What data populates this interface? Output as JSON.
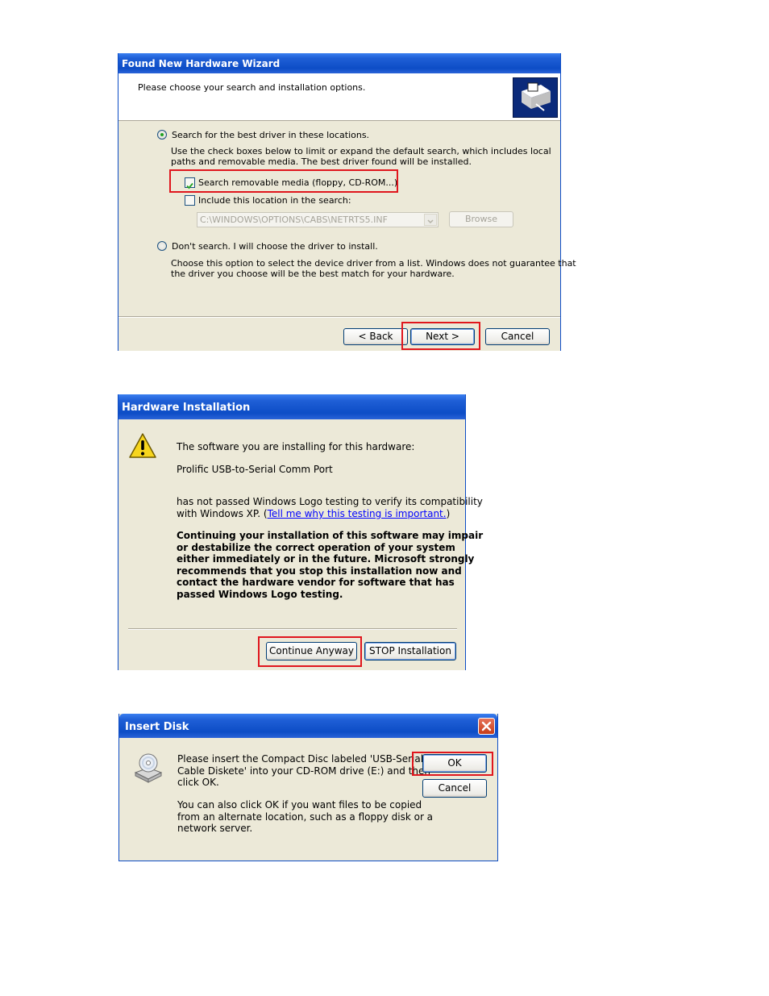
{
  "wizard": {
    "title": "Found New Hardware Wizard",
    "header": "Please choose your search and installation options.",
    "icon": "hardware-wizard-icon",
    "option_search": "Search for the best driver in these locations.",
    "search_desc_1": "Use the check boxes below to limit or expand the default search, which includes local",
    "search_desc_2": "paths and removable media. The best driver found will be installed.",
    "check_removable": "Search removable media (floppy, CD-ROM...)",
    "check_removable_checked": true,
    "check_location": "Include this location in the search:",
    "check_location_checked": false,
    "path_value": "C:\\WINDOWS\\OPTIONS\\CABS\\NETRTS5.INF",
    "browse_label": "Browse",
    "option_dont_search": "Don't search. I will choose the driver to install.",
    "dont_desc_1": "Choose this option to select the device driver from a list.  Windows does not guarantee that",
    "dont_desc_2": "the driver you choose will be the best match for your hardware.",
    "back_label": "< Back",
    "next_label": "Next >",
    "cancel_label": "Cancel"
  },
  "hardware": {
    "title": "Hardware Installation",
    "icon": "warning-icon",
    "line1": "The software you are installing for this hardware:",
    "device": "Prolific USB-to-Serial Comm Port",
    "line2": "has not passed Windows Logo testing to verify its compatibility",
    "line3_prefix": "with Windows XP. (",
    "link": "Tell me why this testing is important.",
    "line3_suffix": ")",
    "warning": [
      "Continuing your installation of this software may impair",
      "or destabilize the correct operation of your system",
      "either immediately or in the future. Microsoft strongly",
      "recommends that you stop this installation now and",
      "contact the hardware vendor for software that has",
      "passed Windows Logo testing."
    ],
    "continue_label": "Continue Anyway",
    "stop_label": "STOP Installation"
  },
  "insert": {
    "title": "Insert Disk",
    "icon": "cd-drive-icon",
    "close_icon": "close-icon",
    "text1": [
      "Please insert the Compact Disc labeled 'USB-Serial",
      "Cable Diskete' into your CD-ROM drive (E:) and then",
      "click OK."
    ],
    "text2": [
      "You can also click OK if you want files to be copied",
      "from an alternate location, such as a floppy disk or a",
      "network server."
    ],
    "ok_label": "OK",
    "cancel_label": "Cancel"
  },
  "colors": {
    "highlight": "#e0161d",
    "titlebar": "#0d4dc6",
    "dialog_bg": "#ece9d8"
  }
}
